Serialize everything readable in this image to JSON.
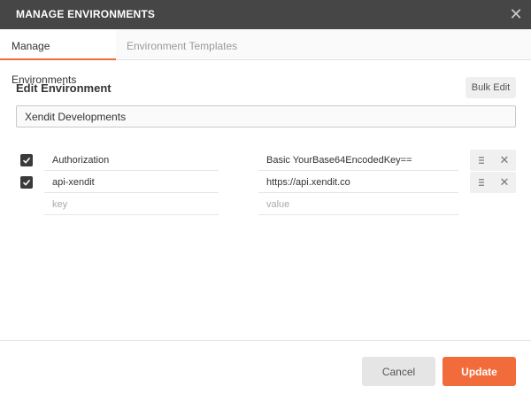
{
  "window": {
    "title": "MANAGE ENVIRONMENTS",
    "close_icon": "close-icon"
  },
  "tabs": [
    {
      "label": "Manage Environments",
      "active": true
    },
    {
      "label": "Environment Templates",
      "active": false
    }
  ],
  "editor": {
    "section_title": "Edit Environment",
    "bulk_edit_label": "Bulk Edit",
    "environment_name": "Xendit Developments"
  },
  "rows": [
    {
      "enabled": true,
      "key": "Authorization",
      "value": "Basic YourBase64EncodedKey=="
    },
    {
      "enabled": true,
      "key": "api-xendit",
      "value": "https://api.xendit.co"
    }
  ],
  "new_row": {
    "key_placeholder": "key",
    "value_placeholder": "value"
  },
  "footer": {
    "cancel_label": "Cancel",
    "update_label": "Update"
  },
  "colors": {
    "titlebar": "#464646",
    "accent": "#f26b3a",
    "checkbox": "#3a3a3a"
  }
}
